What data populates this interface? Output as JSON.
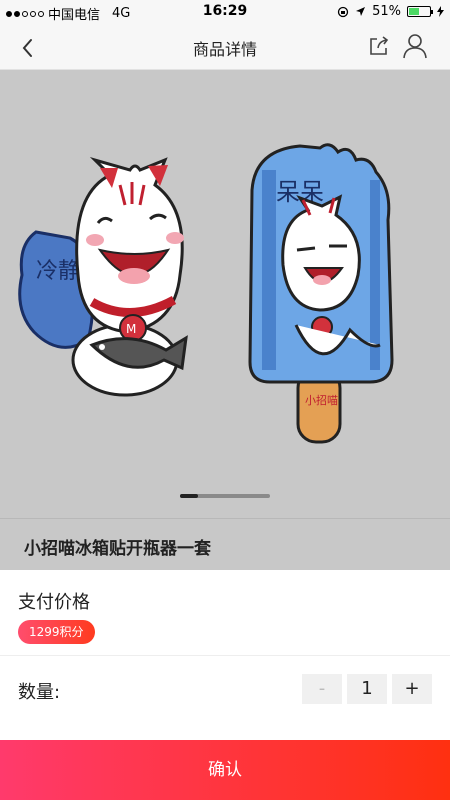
{
  "status_bar": {
    "carrier": "中国电信",
    "network": "4G",
    "time": "16:29",
    "battery_percent": "51%",
    "battery_level": 0.51
  },
  "nav": {
    "title": "商品详情",
    "icons": [
      "back-icon",
      "share-icon",
      "user-icon"
    ]
  },
  "gallery": {
    "seal_text": "冷静",
    "popsicle_text": "呆呆",
    "stick_text": "小招喵",
    "page_position": 0.2
  },
  "product": {
    "title": "小招喵冰箱贴开瓶器一套"
  },
  "price": {
    "label": "支付价格",
    "badge": "1299积分"
  },
  "quantity": {
    "label": "数量:",
    "minus": "-",
    "value": "1",
    "plus": "+"
  },
  "confirm": {
    "label": "确认"
  },
  "colors": {
    "accent_start": "#ff3a6c",
    "accent_end": "#ff3010",
    "battery": "#4cd964"
  }
}
